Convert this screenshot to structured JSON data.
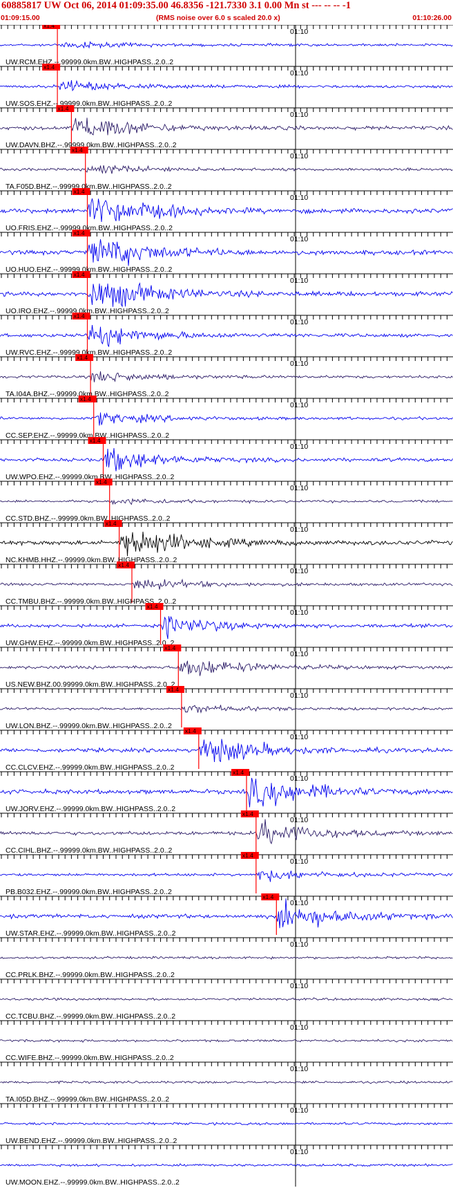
{
  "header": {
    "title": "60885817 UW Oct 06, 2014 01:09:35.00   46.8356 -121.7330  3.1 0.00 Mn st --- -- --   -1",
    "subtitle": "(RMS noise over 6.0 s scaled 20.0 x)",
    "start_time": "01:09:15.00",
    "end_time": "01:10:26.00"
  },
  "chart_data": {
    "type": "line",
    "title": "60885817 UW Oct 06, 2014 01:09:35.00   46.8356 -121.7330  3.1 0.00 Mn st --- -- --   -1",
    "subtitle": "(RMS noise over 6.0 s scaled 20.0 x)",
    "x_range": [
      "01:09:15.00",
      "01:10:26.00"
    ],
    "x_tick_label": "01:10",
    "x_tick_time": "01:10:00",
    "grid": "vertical tick lines every second",
    "pick_label": "x1.4",
    "colors": {
      "blue": "#0000ee",
      "purple": "#2a1a66",
      "black": "#000000",
      "pick": "#ff0000",
      "title": "#d00000"
    },
    "traces": [
      {
        "label": "UW.RCM.EHZ.--.99999.0km.BW..HIGHPASS..2.0..2",
        "color": "blue",
        "pick_time": 8.8,
        "amp": 0.35
      },
      {
        "label": "UW.SOS.EHZ.--.99999.0km.BW..HIGHPASS..2.0..2",
        "color": "blue",
        "pick_time": 8.8,
        "amp": 0.6
      },
      {
        "label": "UW.DAVN.BHZ.--.99999.0km.BW..HIGHPASS..2.0..2",
        "color": "purple",
        "pick_time": 11.0,
        "amp": 1.4
      },
      {
        "label": "TA.F05D.BHZ.--.99999.0km.BW..HIGHPASS..2.0..2",
        "color": "purple",
        "pick_time": 13.2,
        "amp": 0.5
      },
      {
        "label": "UO.FRIS.EHZ.--.99999.0km.BW..HIGHPASS..2.0..2",
        "color": "blue",
        "pick_time": 13.5,
        "amp": 2.0
      },
      {
        "label": "UO.HUO.EHZ.--.99999.0km.BW..HIGHPASS..2.0..2",
        "color": "blue",
        "pick_time": 13.5,
        "amp": 2.0
      },
      {
        "label": "UO.IRO.EHZ.--.99999.0km.BW..HIGHPASS..2.0..2",
        "color": "blue",
        "pick_time": 13.5,
        "amp": 2.0
      },
      {
        "label": "UW.RVC.EHZ.--.99999.0km.BW..HIGHPASS..2.0..2",
        "color": "blue",
        "pick_time": 13.5,
        "amp": 1.2
      },
      {
        "label": "TA.I04A.BHZ.--.99999.0km.BW..HIGHPASS..2.0..2",
        "color": "purple",
        "pick_time": 14.0,
        "amp": 0.6
      },
      {
        "label": "CC.SEP.EHZ.--.99999.0km.BW..HIGHPASS..2.0..2",
        "color": "blue",
        "pick_time": 14.5,
        "amp": 0.6
      },
      {
        "label": "UW.WPO.EHZ.--.99999.0km.BW..HIGHPASS..2.0..2",
        "color": "blue",
        "pick_time": 16.0,
        "amp": 1.2
      },
      {
        "label": "CC.STD.BHZ.--.99999.0km.BW..HIGHPASS..2.0..2",
        "color": "purple",
        "pick_time": 17.0,
        "amp": 0.3
      },
      {
        "label": "NC.KHMB.HHZ.--.99999.0km.BW..HIGHPASS..2.0..2",
        "color": "black",
        "pick_time": 18.5,
        "amp": 1.9
      },
      {
        "label": "CC.TMBU.BHZ.--.99999.0km.BW..HIGHPASS..2.0..2",
        "color": "purple",
        "pick_time": 20.5,
        "amp": 0.6
      },
      {
        "label": "UW.GHW.EHZ.--.99999.0km.BW..HIGHPASS..2.0..2",
        "color": "blue",
        "pick_time": 25.0,
        "amp": 1.1
      },
      {
        "label": "US.NEW.BHZ.00.99999.0km.BW..HIGHPASS..2.0..2",
        "color": "purple",
        "pick_time": 27.8,
        "amp": 1.1
      },
      {
        "label": "UW.LON.BHZ.--.99999.0km.BW..HIGHPASS..2.0..2",
        "color": "purple",
        "pick_time": 28.3,
        "amp": 0.4
      },
      {
        "label": "CC.CLCV.EHZ.--.99999.0km.BW..HIGHPASS..2.0..2",
        "color": "blue",
        "pick_time": 31.0,
        "amp": 1.6
      },
      {
        "label": "UW.JORV.EHZ.--.99999.0km.BW..HIGHPASS..2.0..2",
        "color": "blue",
        "pick_time": 38.5,
        "amp": 2.0
      },
      {
        "label": "CC.CIHL.BHZ.--.99999.0km.BW..HIGHPASS..2.0..2",
        "color": "purple",
        "pick_time": 40.0,
        "amp": 1.3
      },
      {
        "label": "PB.B032.EHZ.--.99999.0km.BW..HIGHPASS..2.0..2",
        "color": "blue",
        "pick_time": 40.0,
        "amp": 0.6
      },
      {
        "label": "UW.STAR.EHZ.--.99999.0km.BW..HIGHPASS..2.0..2",
        "color": "blue",
        "pick_time": 43.2,
        "amp": 1.6
      },
      {
        "label": "CC.PRLK.BHZ.--.99999.0km.BW..HIGHPASS..2.0..2",
        "color": "purple",
        "pick_time": null,
        "amp": 0.3
      },
      {
        "label": "CC.TCBU.BHZ.--.99999.0km.BW..HIGHPASS..2.0..2",
        "color": "purple",
        "pick_time": null,
        "amp": 0.3
      },
      {
        "label": "CC.WIFE.BHZ.--.99999.0km.BW..HIGHPASS..2.0..2",
        "color": "purple",
        "pick_time": null,
        "amp": 0.3
      },
      {
        "label": "TA.I05D.BHZ.--.99999.0km.BW..HIGHPASS..2.0..2",
        "color": "purple",
        "pick_time": null,
        "amp": 0.25
      },
      {
        "label": "UW.BEND.EHZ.--.99999.0km.BW..HIGHPASS..2.0..2",
        "color": "blue",
        "pick_time": null,
        "amp": 0.3
      },
      {
        "label": "UW.MOON.EHZ.--.99999.0km.BW..HIGHPASS..2.0..2",
        "color": "blue",
        "pick_time": null,
        "amp": 0.3
      }
    ]
  }
}
